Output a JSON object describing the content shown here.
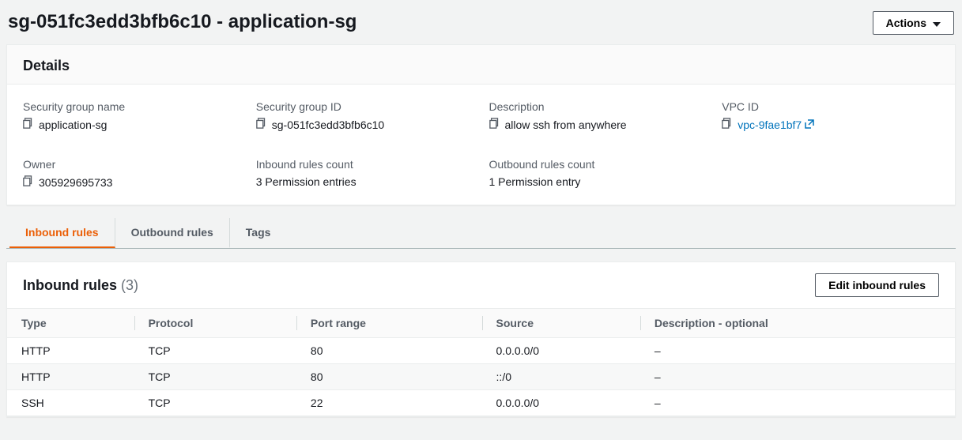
{
  "header": {
    "title": "sg-051fc3edd3bfb6c10 - application-sg",
    "actions_label": "Actions"
  },
  "details": {
    "panel_title": "Details",
    "sg_name_label": "Security group name",
    "sg_name": "application-sg",
    "sg_id_label": "Security group ID",
    "sg_id": "sg-051fc3edd3bfb6c10",
    "desc_label": "Description",
    "desc": "allow ssh from anywhere",
    "vpc_label": "VPC ID",
    "vpc": "vpc-9fae1bf7",
    "owner_label": "Owner",
    "owner": "305929695733",
    "inbound_count_label": "Inbound rules count",
    "inbound_count": "3 Permission entries",
    "outbound_count_label": "Outbound rules count",
    "outbound_count": "1 Permission entry"
  },
  "tabs": {
    "inbound": "Inbound rules",
    "outbound": "Outbound rules",
    "tags": "Tags"
  },
  "rules": {
    "title": "Inbound rules",
    "count": "(3)",
    "edit_label": "Edit inbound rules",
    "cols": {
      "type": "Type",
      "protocol": "Protocol",
      "port": "Port range",
      "source": "Source",
      "desc": "Description - optional"
    },
    "rows": [
      {
        "type": "HTTP",
        "protocol": "TCP",
        "port": "80",
        "source": "0.0.0.0/0",
        "desc": "–"
      },
      {
        "type": "HTTP",
        "protocol": "TCP",
        "port": "80",
        "source": "::/0",
        "desc": "–"
      },
      {
        "type": "SSH",
        "protocol": "TCP",
        "port": "22",
        "source": "0.0.0.0/0",
        "desc": "–"
      }
    ]
  }
}
